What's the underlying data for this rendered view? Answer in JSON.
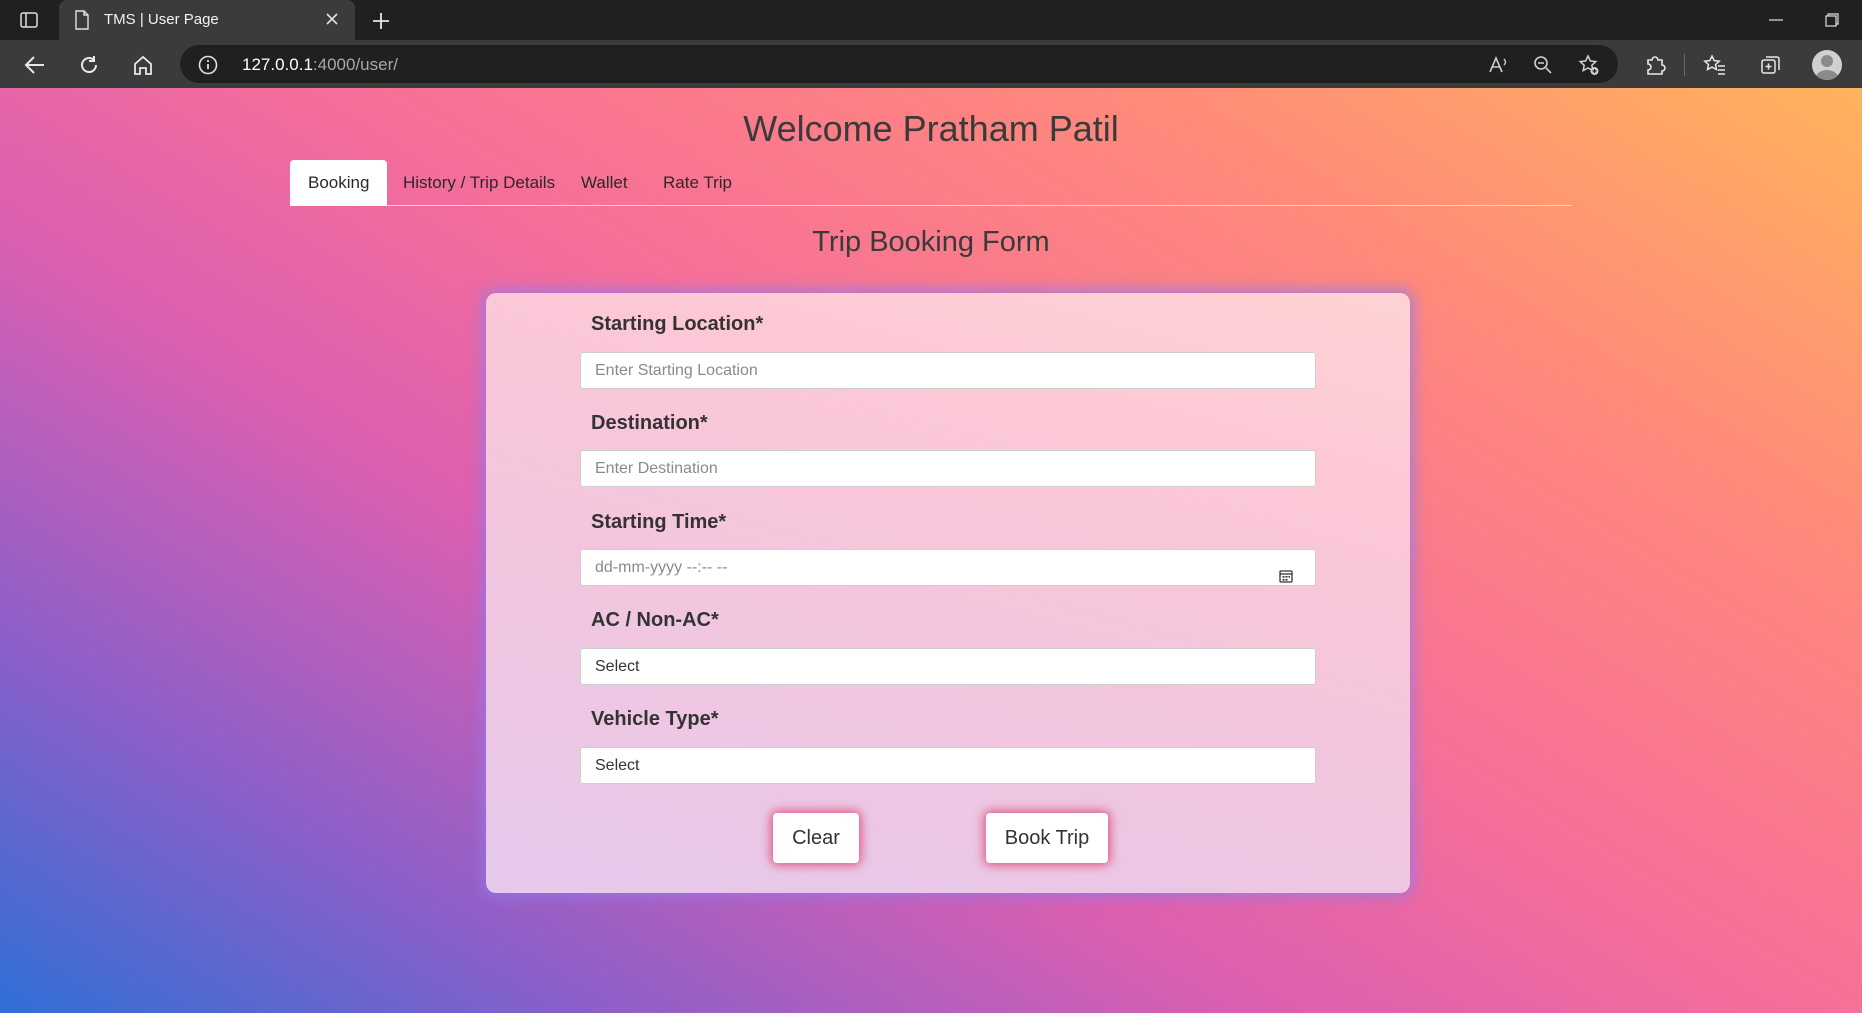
{
  "browser": {
    "tab_title": "TMS | User Page",
    "url_host": "127.0.0.1",
    "url_path": ":4000/user/"
  },
  "page": {
    "welcome": "Welcome Pratham Patil",
    "nav_tabs": [
      {
        "label": "Booking",
        "active": true
      },
      {
        "label": "History / Trip Details",
        "active": false
      },
      {
        "label": "Wallet",
        "active": false
      },
      {
        "label": "Rate Trip",
        "active": false
      }
    ],
    "form_title": "Trip Booking Form",
    "form": {
      "start_label": "Starting Location*",
      "start_placeholder": "Enter Starting Location",
      "dest_label": "Destination*",
      "dest_placeholder": "Enter Destination",
      "time_label": "Starting Time*",
      "time_placeholder": "dd-mm-yyyy --:-- --",
      "ac_label": "AC / Non-AC*",
      "ac_value": "Select",
      "vehicle_label": "Vehicle Type*",
      "vehicle_value": "Select",
      "clear_label": "Clear",
      "book_label": "Book Trip"
    }
  }
}
